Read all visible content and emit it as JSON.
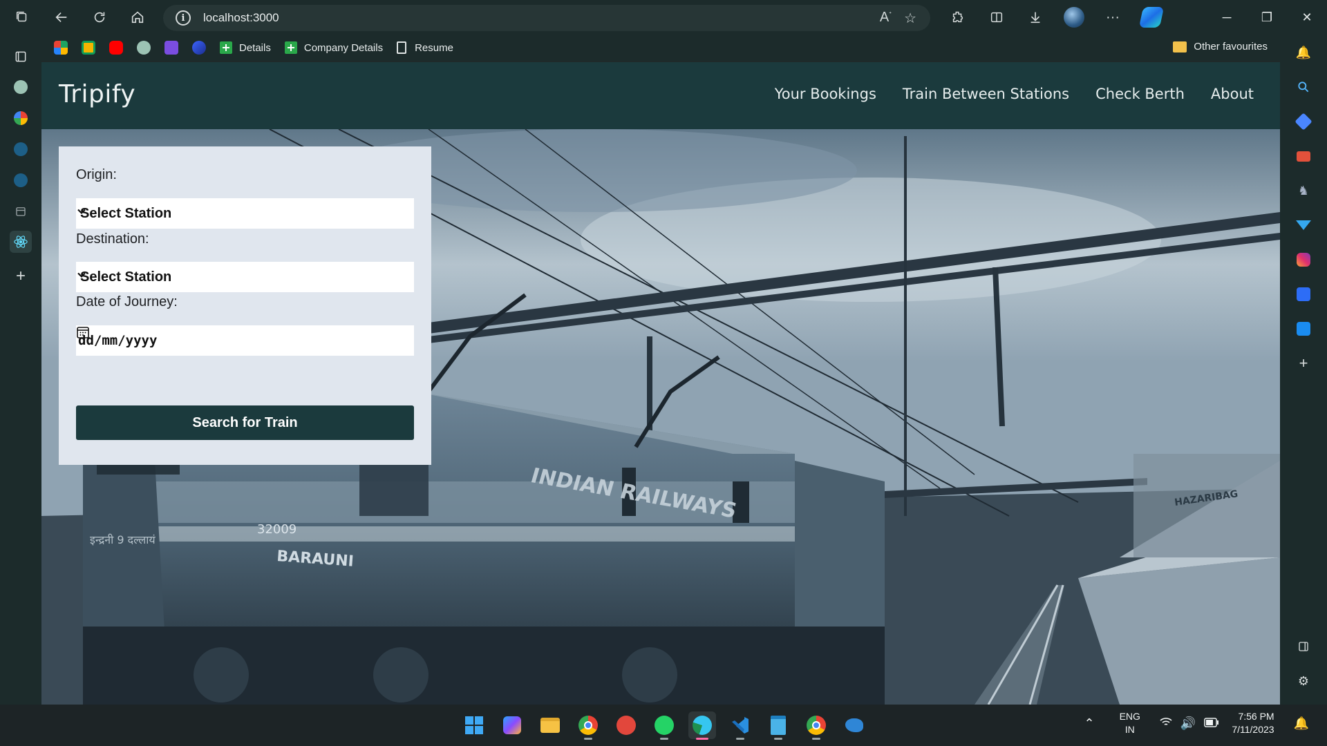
{
  "browser": {
    "url": "localhost:3000",
    "favourites": [
      {
        "label": "Details"
      },
      {
        "label": "Company Details"
      },
      {
        "label": "Resume"
      }
    ],
    "other_favourites": "Other favourites"
  },
  "site": {
    "brand": "Tripify",
    "nav": {
      "your_bookings": "Your Bookings",
      "train_between_stations": "Train Between Stations",
      "check_berth": "Check Berth",
      "about": "About"
    },
    "form": {
      "origin_label": "Origin:",
      "origin_value": "Select Station",
      "destination_label": "Destination:",
      "destination_value": "Select Station",
      "date_label": "Date of Journey:",
      "date_placeholder": "dd/mm/yyyy",
      "search_button": "Search for Train"
    },
    "hero_text": {
      "loco_script": "इन्द्रनी 9 दल्लायं",
      "loco_number": "32009",
      "loco_shed": "BARAUNI",
      "railways": "INDIAN RAILWAYS",
      "station": "HAZARIBAG"
    }
  },
  "taskbar": {
    "lang_top": "ENG",
    "lang_bottom": "IN",
    "time": "7:56 PM",
    "date": "7/11/2023"
  },
  "colors": {
    "navbar": "#1b3a3d",
    "button": "#1b3a3d",
    "form_bg": "#e0e6ee"
  }
}
